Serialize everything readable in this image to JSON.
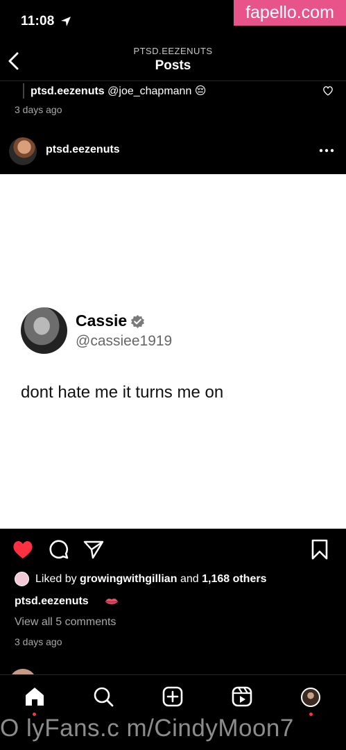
{
  "status_bar": {
    "time": "11:08"
  },
  "watermark": {
    "top": "fapello.com",
    "bottom": "O lyFans.c m/CindyMoon7"
  },
  "header": {
    "username": "PTSD.EEZENUTS",
    "title": "Posts"
  },
  "previous_comment": {
    "username": "ptsd.eezenuts",
    "text": "@joe_chapmann 😔",
    "time": "3 days ago"
  },
  "post": {
    "username": "ptsd.eezenuts",
    "tweet": {
      "name": "Cassie",
      "handle": "@cassiee1919",
      "text": "dont hate me it turns me on"
    },
    "liked_by_prefix": "Liked by",
    "liked_by_user": "growingwithgillian",
    "liked_by_and": "and",
    "liked_by_others": "1,168 others",
    "caption_user": "ptsd.eezenuts",
    "view_comments": "View all 5 comments",
    "time": "3 days ago"
  },
  "icons": {
    "like": "heart-filled-icon",
    "comment": "comment-icon",
    "share": "paper-plane-icon",
    "save": "bookmark-icon"
  },
  "colors": {
    "like": "#ff3040",
    "watermark_bg": "#e8548a",
    "background": "#000000"
  }
}
